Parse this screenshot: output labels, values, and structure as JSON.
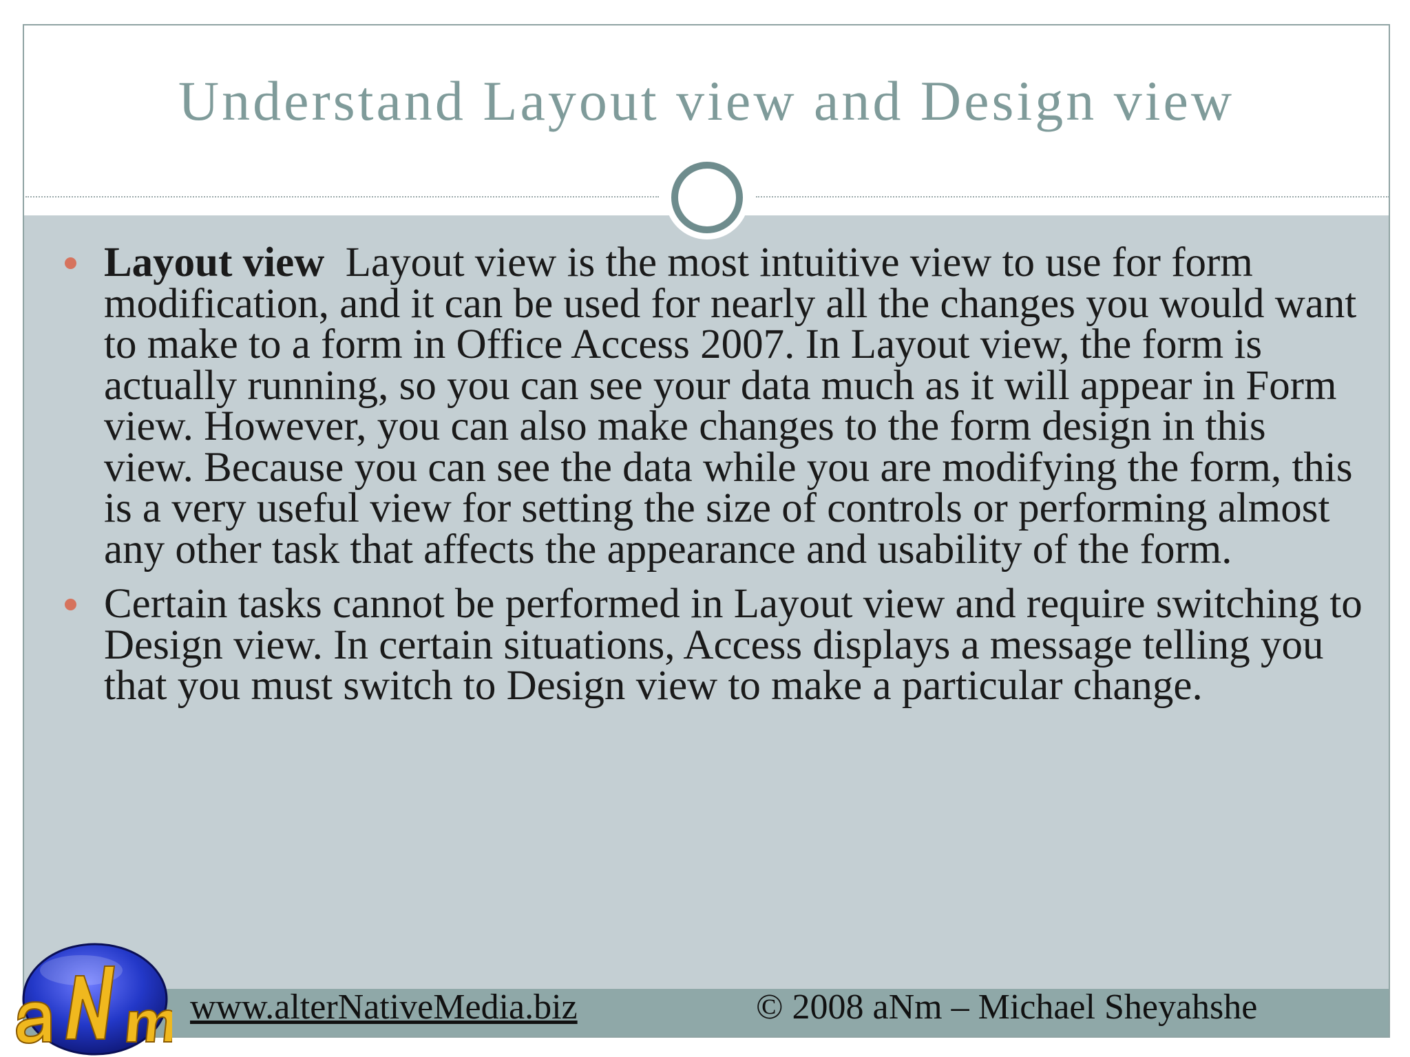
{
  "slide": {
    "title": "Understand Layout view and Design view",
    "bullets": [
      {
        "term": "Layout view",
        "text": "Layout view is the most intuitive view to use for form modification, and it can be used for nearly all the changes you would want to make to a form in Office Access 2007. In Layout view, the form is actually running, so you can see your data much as it will appear in Form view. However, you can also make changes to the form design in this view. Because you can see the data while you are modifying the form, this is a very useful view for setting the size of controls or performing almost any other task that affects the appearance and usability of the form."
      },
      {
        "term": "",
        "text": "Certain tasks cannot be performed in Layout view and require switching to Design view. In certain situations, Access displays a message telling you that you must switch to Design view to make a particular change."
      }
    ]
  },
  "footer": {
    "website": "www.alterNativeMedia.biz",
    "copyright": "© 2008 aNm – Michael Sheyahshe"
  },
  "logo": {
    "text": "aNm",
    "icon": "anm-logo"
  },
  "colors": {
    "title": "#7f9b9a",
    "content_background": "#c4cfd3",
    "footer_band": "#8fa8a8",
    "bullet": "#d6735d",
    "circle": "#6e8c8d"
  }
}
